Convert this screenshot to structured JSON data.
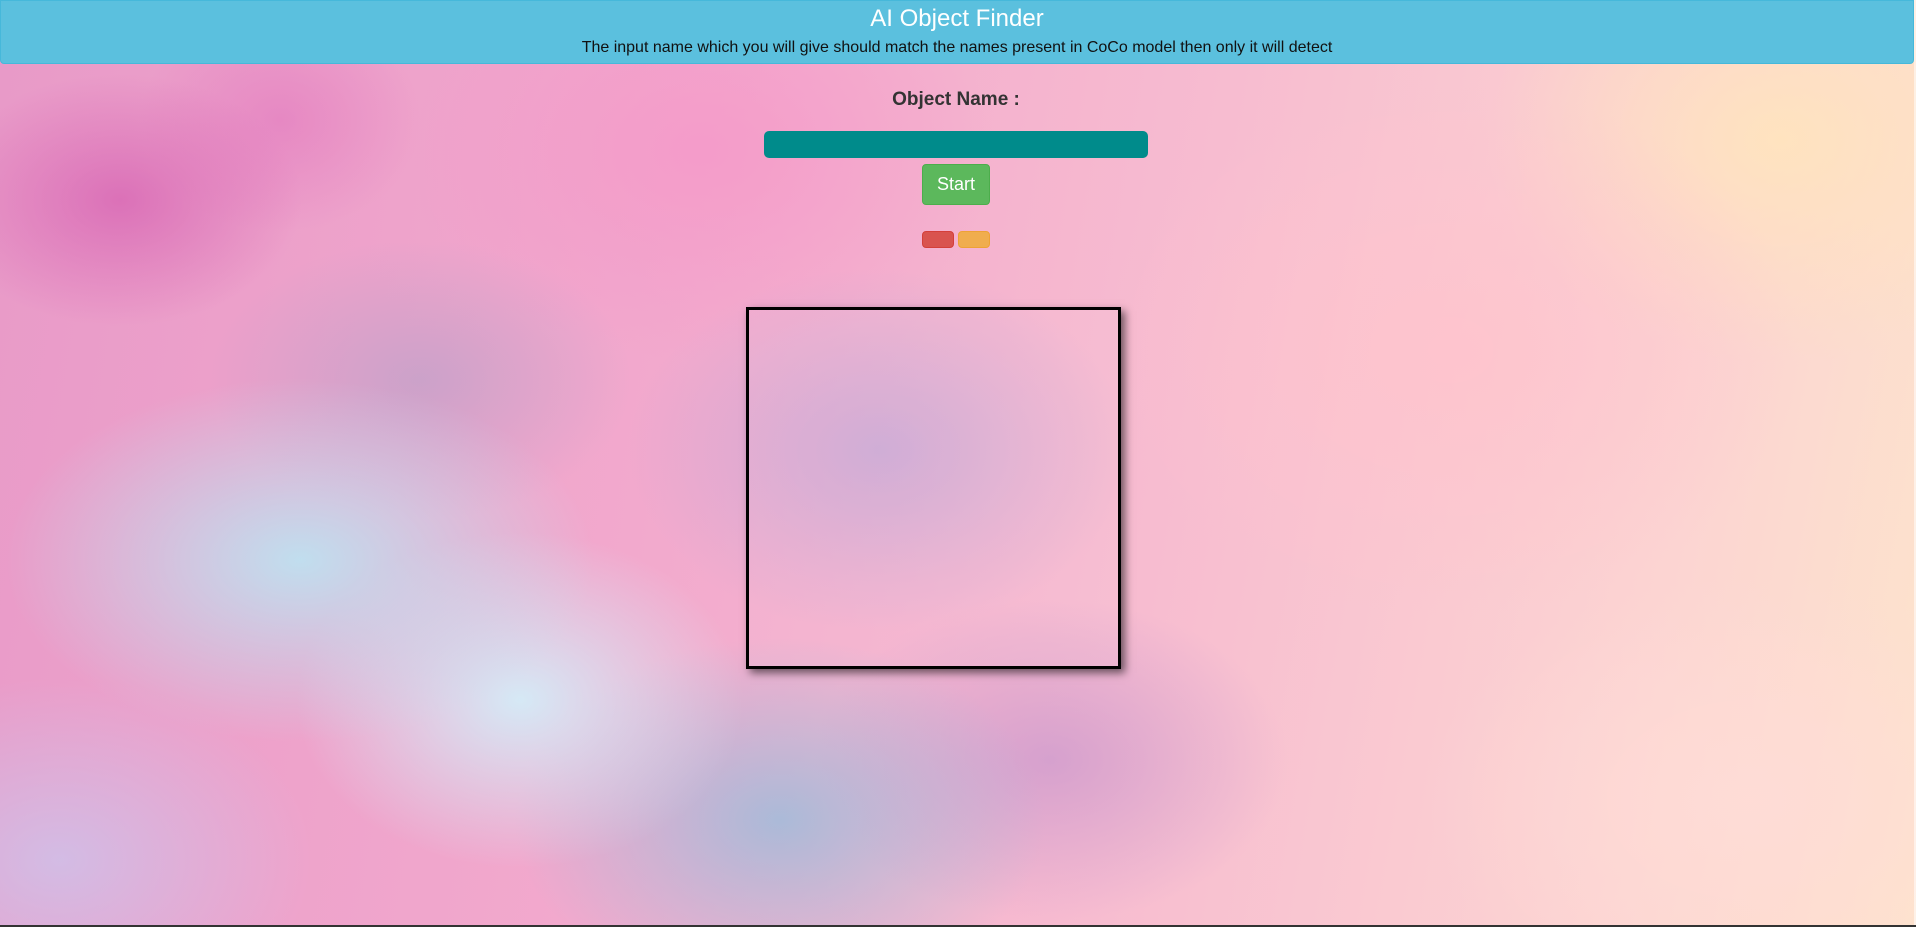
{
  "header": {
    "title": "AI Object Finder",
    "subtitle": "The input name which you will give should match the names present in CoCo model then only it will detect"
  },
  "form": {
    "label": "Object Name :",
    "input_value": "",
    "start_label": "Start"
  },
  "colors": {
    "header_bg": "#5bc0de",
    "input_bg": "#008b8b",
    "start_bg": "#5cb85c",
    "stop_bg": "#d9534f",
    "pause_bg": "#f0ad4e"
  }
}
